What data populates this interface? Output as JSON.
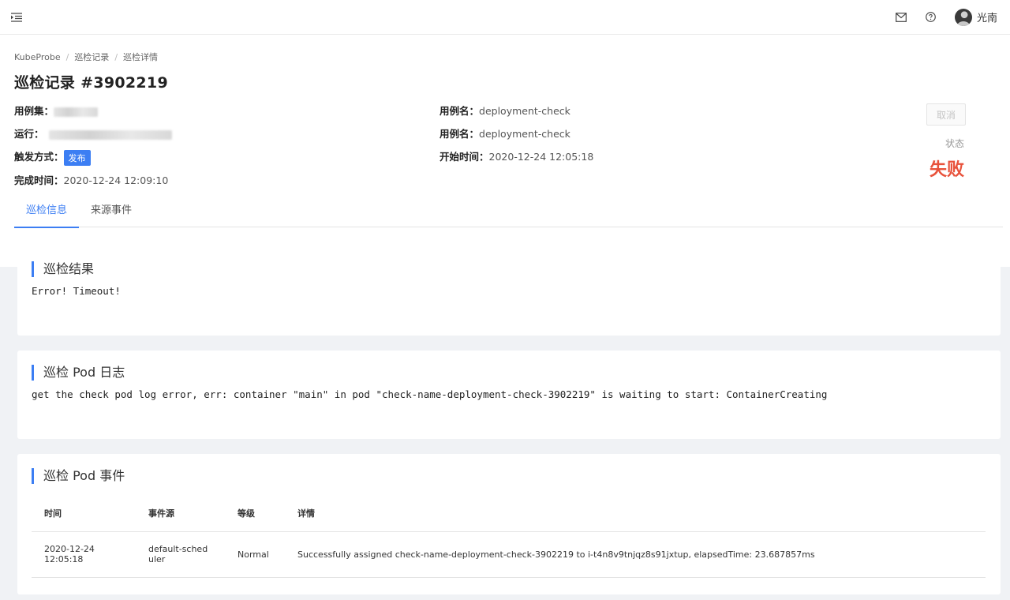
{
  "topbar": {
    "menu_icon": "menu-fold-icon",
    "mail_icon": "mail-icon",
    "help_icon": "question-circle-icon",
    "user_name": "光南"
  },
  "breadcrumb": [
    "KubeProbe",
    "巡检记录",
    "巡检详情"
  ],
  "breadcrumb_sep": "/",
  "page_title": "巡检记录 #3902219",
  "info": {
    "case_set_label": "用例集：",
    "run_label": "运行：",
    "run_value_visible": "...",
    "trigger_label": "触发方式：",
    "trigger_tag": "发布",
    "finish_time_label": "完成时间：",
    "finish_time": "2020-12-24 12:09:10",
    "case_name_label_1": "用例名：",
    "case_name_1": "deployment-check",
    "case_name_label_2": "用例名：",
    "case_name_2": "deployment-check",
    "start_time_label": "开始时间：",
    "start_time": "2020-12-24 12:05:18"
  },
  "actions": {
    "cancel": "取消"
  },
  "status": {
    "label": "状态",
    "value": "失败",
    "color": "#e8523b"
  },
  "tabs": [
    {
      "label": "巡检信息",
      "active": true
    },
    {
      "label": "来源事件",
      "active": false
    }
  ],
  "result_card": {
    "title": "巡检结果",
    "content": "Error! Timeout!"
  },
  "log_card": {
    "title": "巡检 Pod 日志",
    "content": "get the check pod log error, err: container \"main\" in pod \"check-name-deployment-check-3902219\" is waiting to start: ContainerCreating"
  },
  "events_card": {
    "title": "巡检 Pod 事件",
    "columns": [
      "时间",
      "事件源",
      "等级",
      "详情"
    ],
    "rows": [
      {
        "time": "2020-12-24 12:05:18",
        "source": "default-scheduler",
        "level": "Normal",
        "detail": "Successfully assigned check-name-deployment-check-3902219 to i-t4n8v9tnjqz8s91jxtup, elapsedTime: 23.687857ms"
      }
    ]
  },
  "colors": {
    "accent": "#3c7ef3",
    "danger": "#e8523b"
  }
}
